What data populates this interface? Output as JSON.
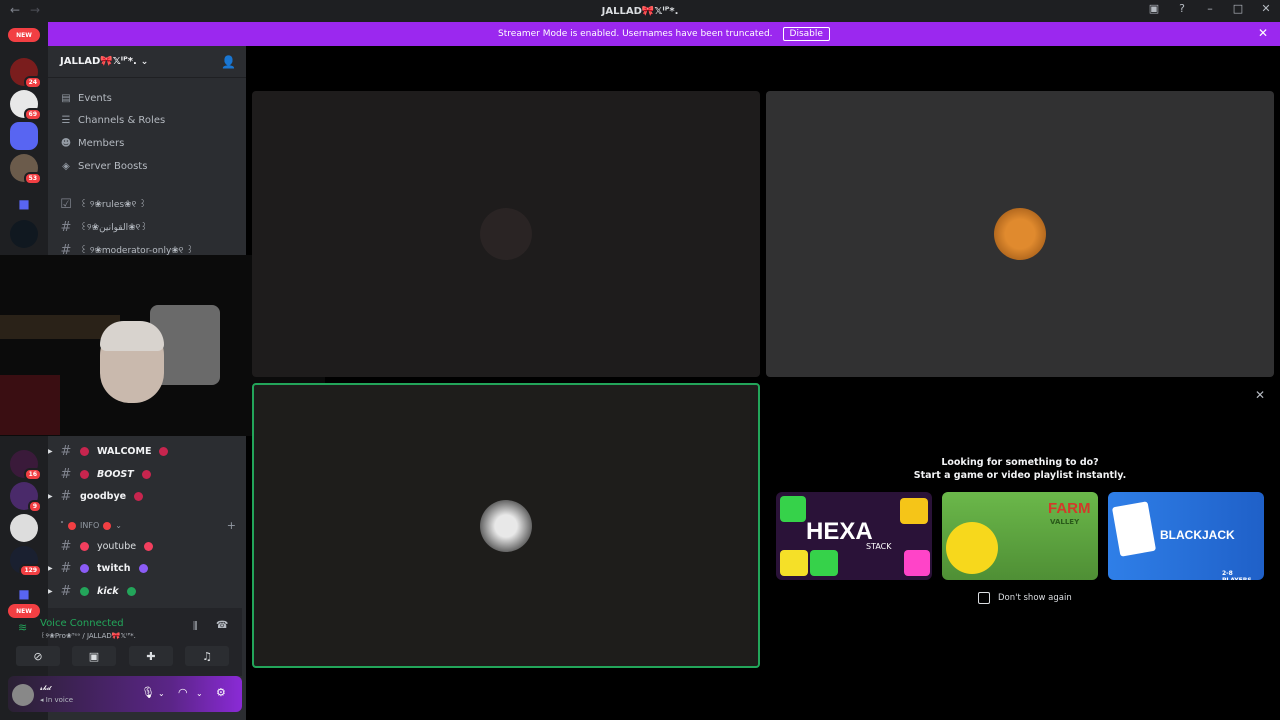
{
  "titlebar": {
    "title": "JALLAD🎀𝕏ᴵᴾ*."
  },
  "banner": {
    "text": "Streamer Mode is enabled. Usernames have been truncated.",
    "button": "Disable"
  },
  "rail": {
    "new_top": "NEW",
    "new_bottom": "NEW",
    "badges": [
      "24",
      "69",
      "53",
      "16",
      "9",
      "129"
    ]
  },
  "server": {
    "name": "JALLAD🎀𝕏ᴵᴾ*.",
    "menu": [
      "Events",
      "Channels & Roles",
      "Members",
      "Server Boosts"
    ],
    "channels_top": [
      "꒰ ୨❀rules❀୧ ꒱",
      "꒰୨❀القوانين❀୧꒱",
      "꒰ ୨❀moderator-only❀୧ ꒱"
    ],
    "channels_mid": [
      "WALCOME",
      "BOOST",
      "goodbye"
    ],
    "category": "INFO",
    "channels_info": [
      "youtube",
      "twitch",
      "kick"
    ]
  },
  "voice": {
    "title": "Voice Connected",
    "sub": "꒰୨❀Pro❀ᵀᵉᵃ / JALLAD🎀𝕏ᴵᴾ*."
  },
  "user": {
    "name": "𝓼𝓴𝓭",
    "status": "In voice"
  },
  "games": {
    "heading1": "Looking for something to do?",
    "heading2": "Start a game or video playlist instantly.",
    "cards": [
      {
        "title": "HEXA",
        "subtitle": "STACK"
      },
      {
        "title": "FARM",
        "subtitle": "VALLEY"
      },
      {
        "title": "BLACKJACK",
        "subtitle": "2-8 PLAYERS"
      }
    ],
    "dont_show": "Don't show again"
  },
  "colors": {
    "accent": "#9b28ef",
    "green": "#23a55a",
    "red": "#f23f43"
  }
}
